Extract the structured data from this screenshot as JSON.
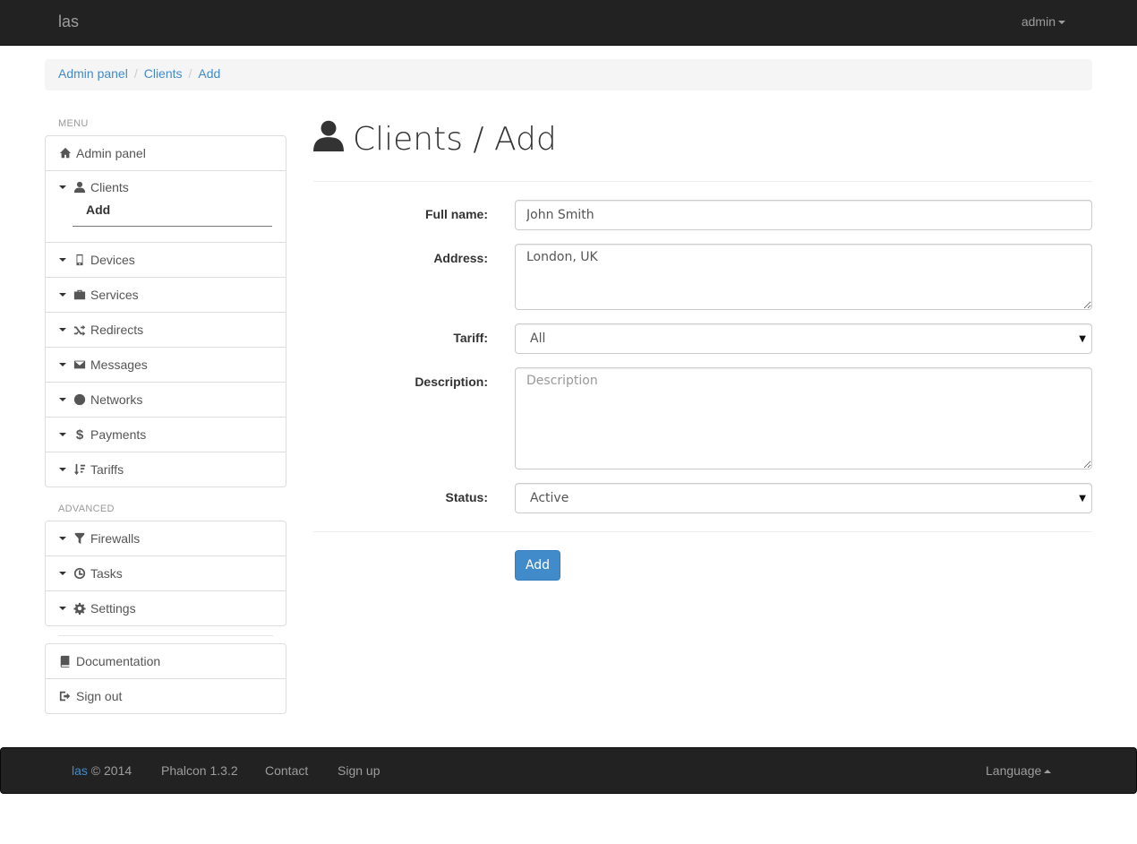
{
  "navbar": {
    "brand": "las",
    "user": "admin"
  },
  "breadcrumb": [
    "Admin panel",
    "Clients",
    "Add"
  ],
  "sidebar": {
    "menu_header": "MENU",
    "advanced_header": "ADVANCED",
    "items": [
      {
        "label": "Admin panel",
        "icon": "home-icon"
      },
      {
        "label": "Clients",
        "icon": "user-icon",
        "expanded": true,
        "subitems": [
          "Add"
        ]
      },
      {
        "label": "Devices",
        "icon": "phone-icon"
      },
      {
        "label": "Services",
        "icon": "briefcase-icon"
      },
      {
        "label": "Redirects",
        "icon": "random-icon"
      },
      {
        "label": "Messages",
        "icon": "envelope-icon"
      },
      {
        "label": "Networks",
        "icon": "globe-icon"
      },
      {
        "label": "Payments",
        "icon": "dollar-icon"
      },
      {
        "label": "Tariffs",
        "icon": "sort-icon"
      }
    ],
    "advanced_items": [
      {
        "label": "Firewalls",
        "icon": "filter-icon"
      },
      {
        "label": "Tasks",
        "icon": "clock-icon"
      },
      {
        "label": "Settings",
        "icon": "gear-icon"
      }
    ],
    "bottom_items": [
      {
        "label": "Documentation",
        "icon": "book-icon"
      },
      {
        "label": "Sign out",
        "icon": "sign-out-icon"
      }
    ]
  },
  "page": {
    "title": "Clients / Add"
  },
  "form": {
    "full_name": {
      "label": "Full name:",
      "value": "John Smith"
    },
    "address": {
      "label": "Address:",
      "value": "London, UK"
    },
    "tariff": {
      "label": "Tariff:",
      "selected": "All"
    },
    "description": {
      "label": "Description:",
      "value": "",
      "placeholder": "Description"
    },
    "status": {
      "label": "Status:",
      "selected": "Active"
    },
    "submit_label": "Add"
  },
  "footer": {
    "brand": "las",
    "copyright": "© 2014",
    "version": "Phalcon 1.3.2",
    "contact": "Contact",
    "signup": "Sign up",
    "language": "Language"
  }
}
